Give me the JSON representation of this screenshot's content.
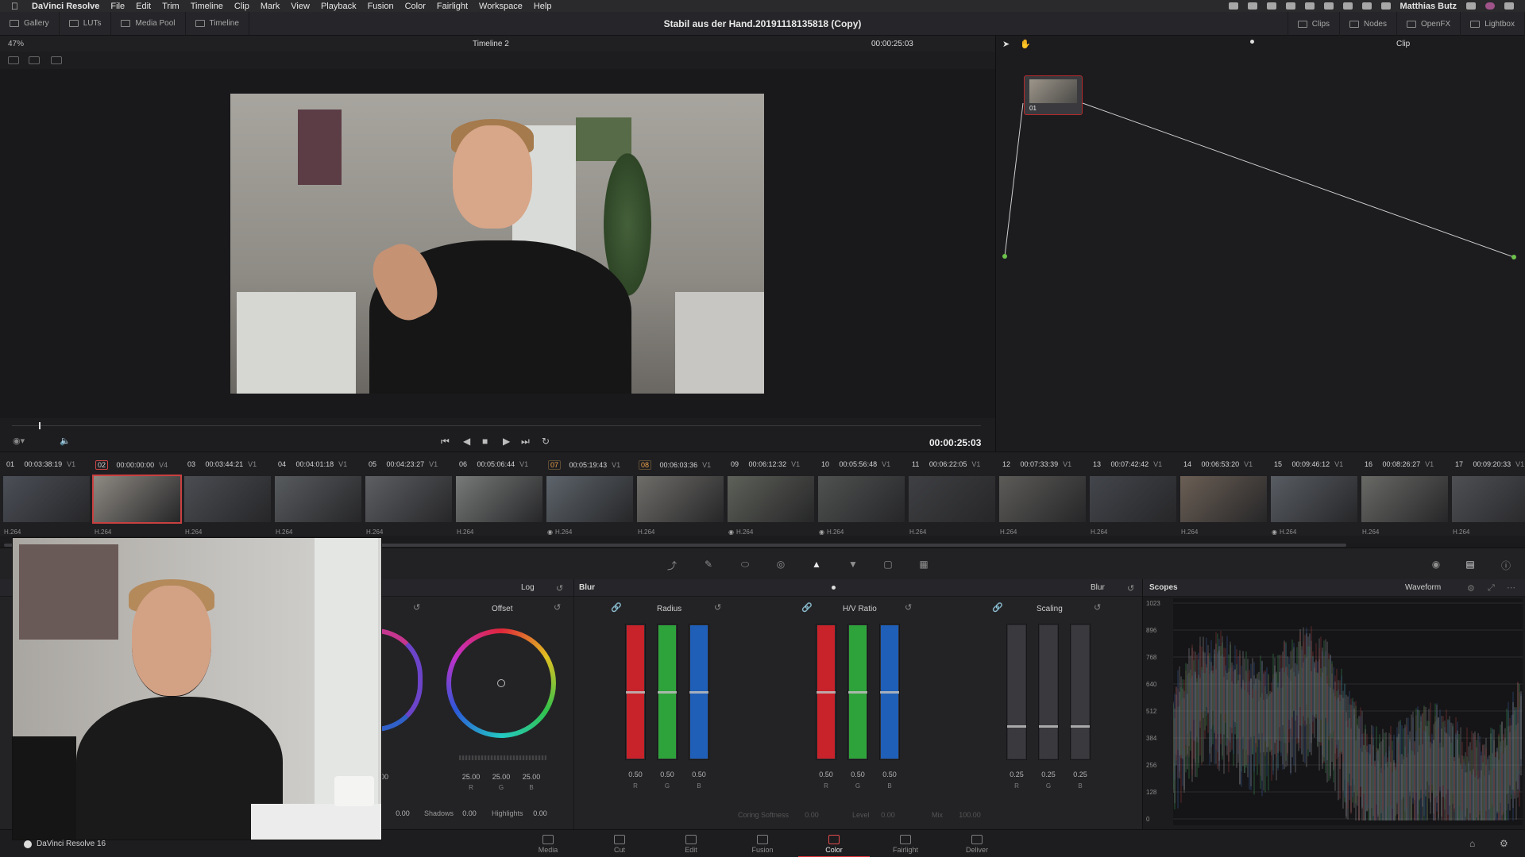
{
  "menubar": {
    "app": "DaVinci Resolve",
    "items": [
      "File",
      "Edit",
      "Trim",
      "Timeline",
      "Clip",
      "Mark",
      "View",
      "Playback",
      "Fusion",
      "Color",
      "Fairlight",
      "Workspace",
      "Help"
    ],
    "user": "Matthias Butz"
  },
  "toolbar": {
    "gallery": "Gallery",
    "luts": "LUTs",
    "media_pool": "Media Pool",
    "timeline": "Timeline",
    "project_title": "Stabil aus der Hand.20191118135818 (Copy)",
    "clips": "Clips",
    "nodes": "Nodes",
    "openfx": "OpenFX",
    "lightbox": "Lightbox"
  },
  "viewer": {
    "zoom": "47%",
    "timeline_name": "Timeline 2",
    "timecode_top": "00:00:25:03",
    "timecode_main": "00:00:25:03"
  },
  "node_editor": {
    "mode": "Clip",
    "node_label": "01"
  },
  "clips": [
    {
      "num": "01",
      "tc": "00:03:38:19",
      "track": "V1",
      "codec": "H.264",
      "style": "normal",
      "fx": false,
      "thumb": "#4b4f57"
    },
    {
      "num": "02",
      "tc": "00:00:00:00",
      "track": "V4",
      "codec": "H.264",
      "style": "selected",
      "fx": false,
      "thumb": "#8e8a83"
    },
    {
      "num": "03",
      "tc": "00:03:44:21",
      "track": "V1",
      "codec": "H.264",
      "style": "normal",
      "fx": false,
      "thumb": "#4a4d52"
    },
    {
      "num": "04",
      "tc": "00:04:01:18",
      "track": "V1",
      "codec": "H.264",
      "style": "normal",
      "fx": false,
      "thumb": "#585b5e"
    },
    {
      "num": "05",
      "tc": "00:04:23:27",
      "track": "V1",
      "codec": "H.264",
      "style": "normal",
      "fx": false,
      "thumb": "#5d5f63"
    },
    {
      "num": "06",
      "tc": "00:05:06:44",
      "track": "V1",
      "codec": "H.264",
      "style": "normal",
      "fx": false,
      "thumb": "#777a78"
    },
    {
      "num": "07",
      "tc": "00:05:19:43",
      "track": "V1",
      "codec": "H.264",
      "style": "orange",
      "fx": true,
      "thumb": "#5d646b"
    },
    {
      "num": "08",
      "tc": "00:06:03:36",
      "track": "V1",
      "codec": "H.264",
      "style": "orange",
      "fx": false,
      "thumb": "#6f6d69"
    },
    {
      "num": "09",
      "tc": "00:06:12:32",
      "track": "V1",
      "codec": "H.264",
      "style": "normal",
      "fx": true,
      "thumb": "#5e6159"
    },
    {
      "num": "10",
      "tc": "00:05:56:48",
      "track": "V1",
      "codec": "H.264",
      "style": "normal",
      "fx": true,
      "thumb": "#4f5251"
    },
    {
      "num": "11",
      "tc": "00:06:22:05",
      "track": "V1",
      "codec": "H.264",
      "style": "normal",
      "fx": false,
      "thumb": "#3f4043"
    },
    {
      "num": "12",
      "tc": "00:07:33:39",
      "track": "V1",
      "codec": "H.264",
      "style": "normal",
      "fx": false,
      "thumb": "#5c5b58"
    },
    {
      "num": "13",
      "tc": "00:07:42:42",
      "track": "V1",
      "codec": "H.264",
      "style": "normal",
      "fx": false,
      "thumb": "#43464c"
    },
    {
      "num": "14",
      "tc": "00:06:53:20",
      "track": "V1",
      "codec": "H.264",
      "style": "normal",
      "fx": false,
      "thumb": "#6b5f55"
    },
    {
      "num": "15",
      "tc": "00:09:46:12",
      "track": "V1",
      "codec": "H.264",
      "style": "normal",
      "fx": true,
      "thumb": "#585d63"
    },
    {
      "num": "16",
      "tc": "00:08:26:27",
      "track": "V1",
      "codec": "H.264",
      "style": "normal",
      "fx": false,
      "thumb": "#696a66"
    },
    {
      "num": "17",
      "tc": "00:09:20:33",
      "track": "V1",
      "codec": "H.264",
      "style": "normal",
      "fx": false,
      "thumb": "#4e5054"
    }
  ],
  "primaries": {
    "mode": "Log",
    "offset_label": "Offset",
    "offset_values": [
      "25.00",
      "25.00",
      "25.00"
    ],
    "left_value": "00",
    "contrast_value": "0.00",
    "shadows_label": "Shadows",
    "shadows_value": "0.00",
    "highlights_label": "Highlights",
    "highlights_value": "0.00",
    "rgb": [
      "R",
      "G",
      "B"
    ]
  },
  "blur": {
    "title": "Blur",
    "mode": "Blur",
    "radius_label": "Radius",
    "radius_values": [
      "0.50",
      "0.50",
      "0.50"
    ],
    "hv_label": "H/V Ratio",
    "hv_values": [
      "0.50",
      "0.50",
      "0.50"
    ],
    "scaling_label": "Scaling",
    "scaling_values": [
      "0.25",
      "0.25",
      "0.25"
    ],
    "coring_label": "Coring Softness",
    "coring_value": "0.00",
    "level_label": "Level",
    "level_value": "0.00",
    "mix_label": "Mix",
    "mix_value": "100.00",
    "radius_level": 0.5,
    "hv_level": 0.5,
    "scaling_level": 0.25
  },
  "scopes": {
    "title": "Scopes",
    "mode": "Waveform",
    "ticks": [
      "1023",
      "896",
      "768",
      "640",
      "512",
      "384",
      "256",
      "128",
      "0"
    ]
  },
  "pages": [
    "Media",
    "Cut",
    "Edit",
    "Fusion",
    "Color",
    "Fairlight",
    "Deliver"
  ],
  "active_page": "Color",
  "webcam_label": "DaVinci Resolve 16",
  "colors": {
    "accent": "#e0323a",
    "red": "#c8222a",
    "green": "#2fa33b",
    "blue": "#1f5fb8"
  }
}
